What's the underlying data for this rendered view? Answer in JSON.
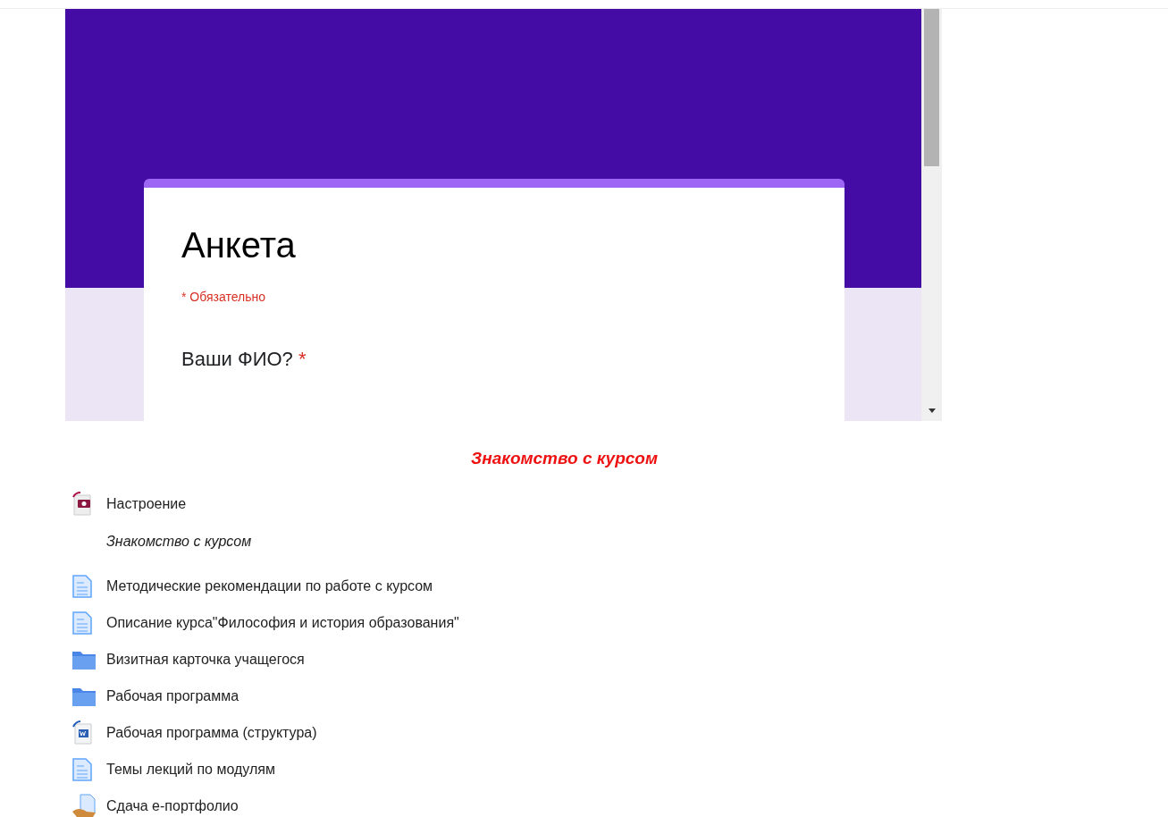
{
  "form": {
    "title": "Анкета",
    "required_note": "* Обязательно",
    "question": {
      "label": "Ваши ФИО?",
      "required_mark": "*"
    }
  },
  "section_title": "Знакомство с курсом",
  "items": [
    {
      "kind": "photo",
      "text": "Настроение"
    },
    {
      "kind": "label",
      "text": "Знакомство с курсом"
    },
    {
      "kind": "page",
      "text": "Методические рекомендации по работе с курсом"
    },
    {
      "kind": "page",
      "text": "Описание курса\"Философия и история образования\""
    },
    {
      "kind": "folder",
      "text": "Визитная карточка учащегося"
    },
    {
      "kind": "folder",
      "text": "Рабочая программа"
    },
    {
      "kind": "word",
      "text": "Рабочая программа (структура)"
    },
    {
      "kind": "page",
      "text": "Темы лекций по модулям"
    },
    {
      "kind": "assign",
      "text": "Сдача е-портфолио"
    }
  ]
}
